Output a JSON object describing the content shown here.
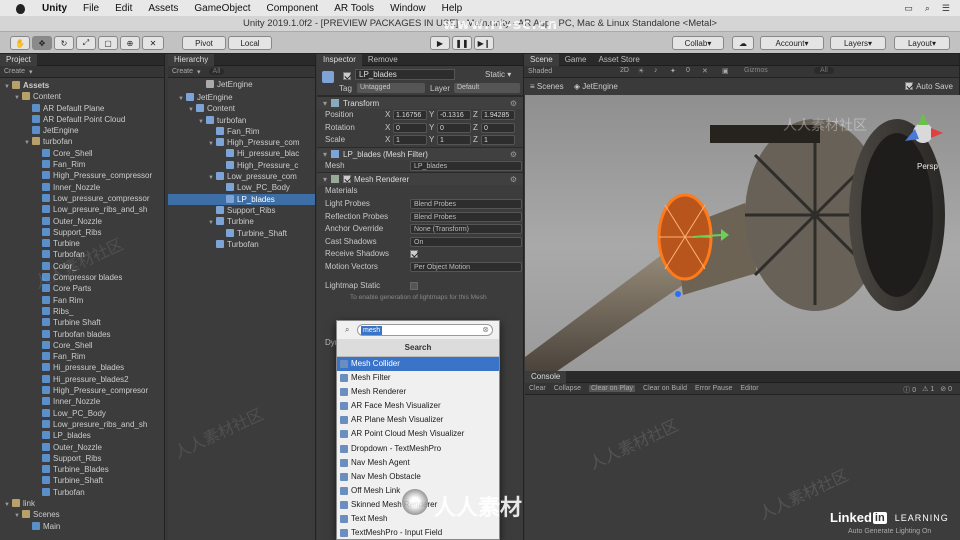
{
  "menubar": {
    "app": "Unity",
    "items": [
      "File",
      "Edit",
      "Assets",
      "GameObject",
      "Component",
      "AR Tools",
      "Window",
      "Help"
    ]
  },
  "window_title": "Unity 2019.1.0f2 - [PREVIEW PACKAGES IN USE] - Main.unity - AR App - PC, Mac & Linux Standalone <Metal>",
  "toolbar": {
    "pivot": "Pivot",
    "local": "Local",
    "collab": "Collab",
    "account": "Account",
    "layers": "Layers",
    "layout": "Layout"
  },
  "project": {
    "tab": "Project",
    "create": "Create",
    "root": "Assets",
    "items": [
      "Content",
      "AR Default Plane",
      "AR Default Point Cloud",
      "JetEngine",
      "turbofan",
      "Core_Shell",
      "Fan_Rim",
      "High_Pressure_compressor",
      "Inner_Nozzle",
      "Low_pressure_compressor",
      "Low_presure_ribs_and_sh",
      "Outer_Nozzle",
      "Support_Ribs",
      "Turbine",
      "Turbofan",
      "Color_",
      "Compressor blades",
      "Core Parts",
      "Fan Rim",
      "Ribs_",
      "Turbine Shaft",
      "Turbofan blades",
      "Core_Shell",
      "Fan_Rim",
      "Hi_pressure_blades",
      "Hi_pressure_blades2",
      "High_Pressure_compresor",
      "Inner_Nozzle",
      "Low_PC_Body",
      "Low_presure_ribs_and_sh",
      "LP_blades",
      "Outer_Nozzle",
      "Support_Ribs",
      "Turbine_Blades",
      "Turbine_Shaft",
      "Turbofan",
      "link",
      "Scenes",
      "Main"
    ]
  },
  "hierarchy": {
    "tab": "Hierarchy",
    "create": "Create",
    "search": "All",
    "scene": "JetEngine",
    "items": [
      "JetEngine",
      "Content",
      "turbofan",
      "Fan_Rim",
      "High_Pressure_com",
      "Hi_pressure_blac",
      "High_Pressure_c",
      "Low_pressure_com",
      "Low_PC_Body",
      "LP_blades",
      "Support_Ribs",
      "Turbine",
      "Turbine_Shaft",
      "Turbofan"
    ]
  },
  "inspector": {
    "tab": "Inspector",
    "tab2": "Remove",
    "object_name": "LP_blades",
    "static": "Static",
    "tag_label": "Tag",
    "tag": "Untagged",
    "layer_label": "Layer",
    "layer": "Default",
    "transform": "Transform",
    "position_label": "Position",
    "position": [
      "1.16756",
      "-0.1316",
      "1.94285"
    ],
    "rotation_label": "Rotation",
    "rotation": [
      "0",
      "0",
      "0"
    ],
    "scale_label": "Scale",
    "scale": [
      "1",
      "1",
      "1"
    ],
    "axis": [
      "X",
      "Y",
      "Z"
    ],
    "mesh_filter": "LP_blades (Mesh Filter)",
    "mesh_label": "Mesh",
    "mesh": "LP_blades",
    "mesh_renderer": "Mesh Renderer",
    "materials": "Materials",
    "props": [
      {
        "label": "Light Probes",
        "value": "Blend Probes"
      },
      {
        "label": "Reflection Probes",
        "value": "Blend Probes"
      },
      {
        "label": "Anchor Override",
        "value": "None (Transform)"
      },
      {
        "label": "Cast Shadows",
        "value": "On"
      },
      {
        "label": "Receive Shadows",
        "value": ""
      },
      {
        "label": "Motion Vectors",
        "value": "Per Object Motion"
      }
    ],
    "lightmap_static": "Lightmap Static",
    "lightmap_hint": "To enable generation of lightmaps for this Mesh",
    "dyn": "Dyn"
  },
  "popup": {
    "search_value": "mesh",
    "heading": "Search",
    "items": [
      "Mesh Collider",
      "Mesh Filter",
      "Mesh Renderer",
      "AR Face Mesh Visualizer",
      "AR Plane Mesh Visualizer",
      "AR Point Cloud Mesh Visualizer",
      "Dropdown - TextMeshPro",
      "Nav Mesh Agent",
      "Nav Mesh Obstacle",
      "Off Mesh Link",
      "Skinned Mesh Renderer",
      "Text Mesh",
      "TextMeshPro - Input Field"
    ],
    "selected": 0
  },
  "scene_view": {
    "tabs": [
      "Scene",
      "Game",
      "Asset Store"
    ],
    "shading": "Shaded",
    "mode2d": "2D",
    "gizmo_count": "0",
    "gizmos": "Gizmos",
    "search": "All",
    "breadcrumb_root": "Scenes",
    "breadcrumb_item": "JetEngine",
    "persp": "Persp",
    "auto_save": "Auto Save"
  },
  "console": {
    "tab": "Console",
    "buttons": [
      "Clear",
      "Collapse",
      "Clear on Play",
      "Clear on Build",
      "Error Pause",
      "Editor"
    ],
    "counts": [
      "0",
      "1",
      "0"
    ]
  },
  "watermark": {
    "site": "www.rr-sc.cn",
    "brand_cn": "人人素材",
    "tile": "人人素材社区",
    "linkedin_a": "Linked",
    "linkedin_b": "in",
    "learning": "LEARNING",
    "tagline": "Auto Generate Lighting On"
  },
  "colors": {
    "selection": "#3d6ea6",
    "menu_selection": "#3a74c8",
    "outline": "#ff7a1a"
  }
}
